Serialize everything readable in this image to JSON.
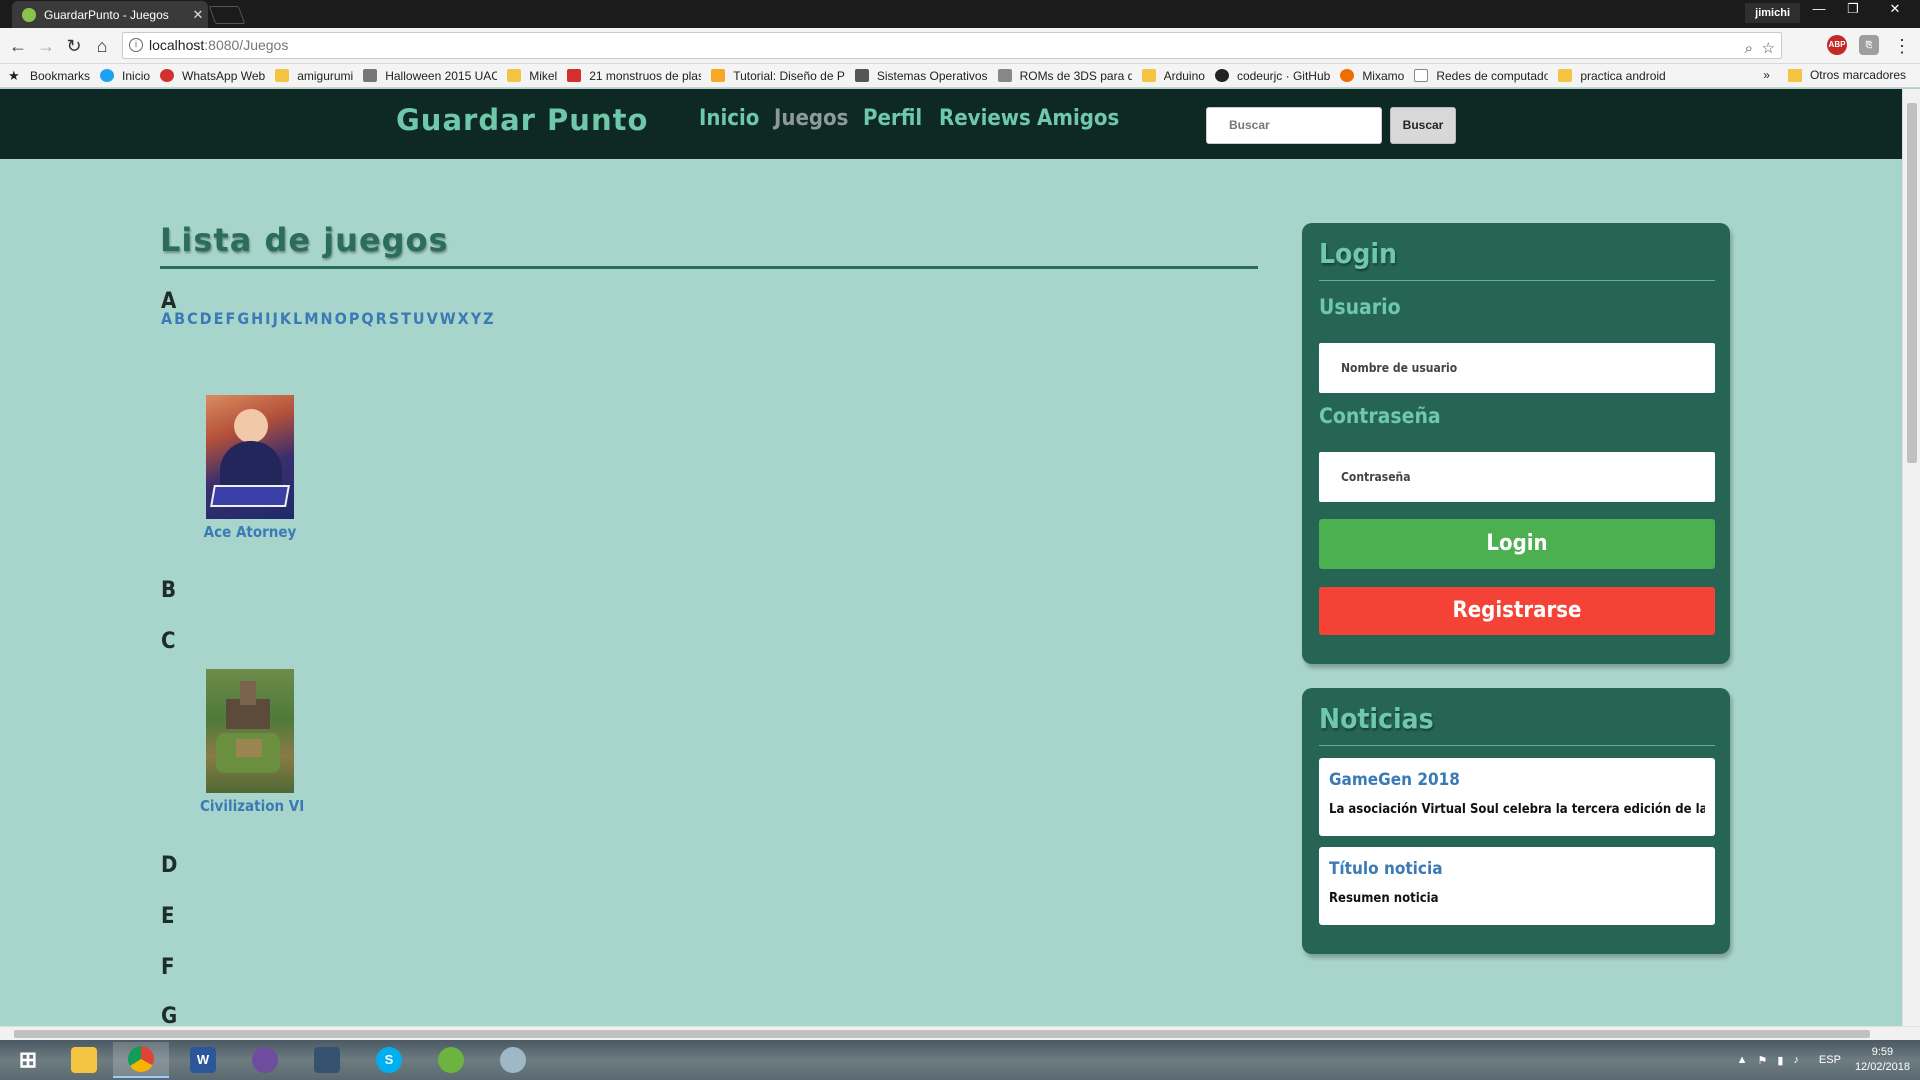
{
  "browser": {
    "tab_title": "GuardarPunto - Juegos",
    "profile": "jimichi",
    "url_host": "localhost",
    "url_path": ":8080/Juegos",
    "bookmarks": [
      {
        "label": "Bookmarks",
        "icon": "star-icon"
      },
      {
        "label": "Inicio",
        "icon": "twitter-icon"
      },
      {
        "label": "WhatsApp Web",
        "icon": "whatsapp-icon"
      },
      {
        "label": "amigurumi",
        "icon": "folder-icon"
      },
      {
        "label": "Halloween 2015 UAC",
        "icon": "page-icon"
      },
      {
        "label": "Mikel",
        "icon": "folder-icon"
      },
      {
        "label": "21 monstruos de plas",
        "icon": "page-icon"
      },
      {
        "label": "Tutorial: Diseño de P",
        "icon": "page-icon"
      },
      {
        "label": "Sistemas Operativos",
        "icon": "page-icon"
      },
      {
        "label": "ROMs de 3DS para d",
        "icon": "page-icon"
      },
      {
        "label": "Arduino",
        "icon": "folder-icon"
      },
      {
        "label": "codeurjc · GitHub",
        "icon": "github-icon"
      },
      {
        "label": "Mixamo",
        "icon": "mixamo-icon"
      },
      {
        "label": "Redes de computado",
        "icon": "page-icon"
      },
      {
        "label": "practica android",
        "icon": "folder-icon"
      }
    ],
    "bookmarks_more": "»",
    "other_bookmarks": "Otros marcadores"
  },
  "site": {
    "brand": "Guardar Punto",
    "nav": [
      "Inicio",
      "Juegos",
      "Perfil",
      "Reviews",
      "Amigos"
    ],
    "active_nav": "Juegos",
    "search_placeholder": "Buscar",
    "search_button": "Buscar"
  },
  "main": {
    "title": "Lista de juegos",
    "alphabet": [
      "A",
      "B",
      "C",
      "D",
      "E",
      "F",
      "G",
      "H",
      "I",
      "J",
      "K",
      "L",
      "M",
      "N",
      "O",
      "P",
      "Q",
      "R",
      "S",
      "T",
      "U",
      "V",
      "W",
      "X",
      "Y",
      "Z"
    ],
    "sections": [
      {
        "letter": "A",
        "games": [
          {
            "title": "Ace Atorney",
            "cover": "ace"
          }
        ]
      },
      {
        "letter": "B",
        "games": []
      },
      {
        "letter": "C",
        "games": [
          {
            "title": "Civilization VI",
            "cover": "civ"
          }
        ]
      },
      {
        "letter": "D",
        "games": []
      },
      {
        "letter": "E",
        "games": []
      },
      {
        "letter": "F",
        "games": []
      },
      {
        "letter": "G",
        "games": []
      }
    ]
  },
  "login": {
    "title": "Login",
    "user_label": "Usuario",
    "user_placeholder": "Nombre de usuario",
    "pass_label": "Contraseña",
    "pass_placeholder": "Contraseña",
    "login_button": "Login",
    "register_button": "Registrarse"
  },
  "news": {
    "title": "Noticias",
    "items": [
      {
        "title": "GameGen 2018",
        "summary": "La asociación Virtual Soul celebra la tercera edición de la GameGen."
      },
      {
        "title": "Título noticia",
        "summary": "Resumen noticia"
      }
    ]
  },
  "taskbar": {
    "apps": [
      "windows-start",
      "file-explorer",
      "chrome",
      "word",
      "github-desktop",
      "mysql-workbench",
      "skype",
      "spring-tool-suite",
      "paint"
    ],
    "language": "ESP",
    "time": "9:59",
    "date": "12/02/2018"
  },
  "colors": {
    "page_bg": "#a8d5cb",
    "header_bg": "#0e2923",
    "brand": "#6ec8a9",
    "panel_bg": "#266554",
    "link": "#3a7ab5",
    "login_btn": "#4caf50",
    "register_btn": "#f44336"
  }
}
